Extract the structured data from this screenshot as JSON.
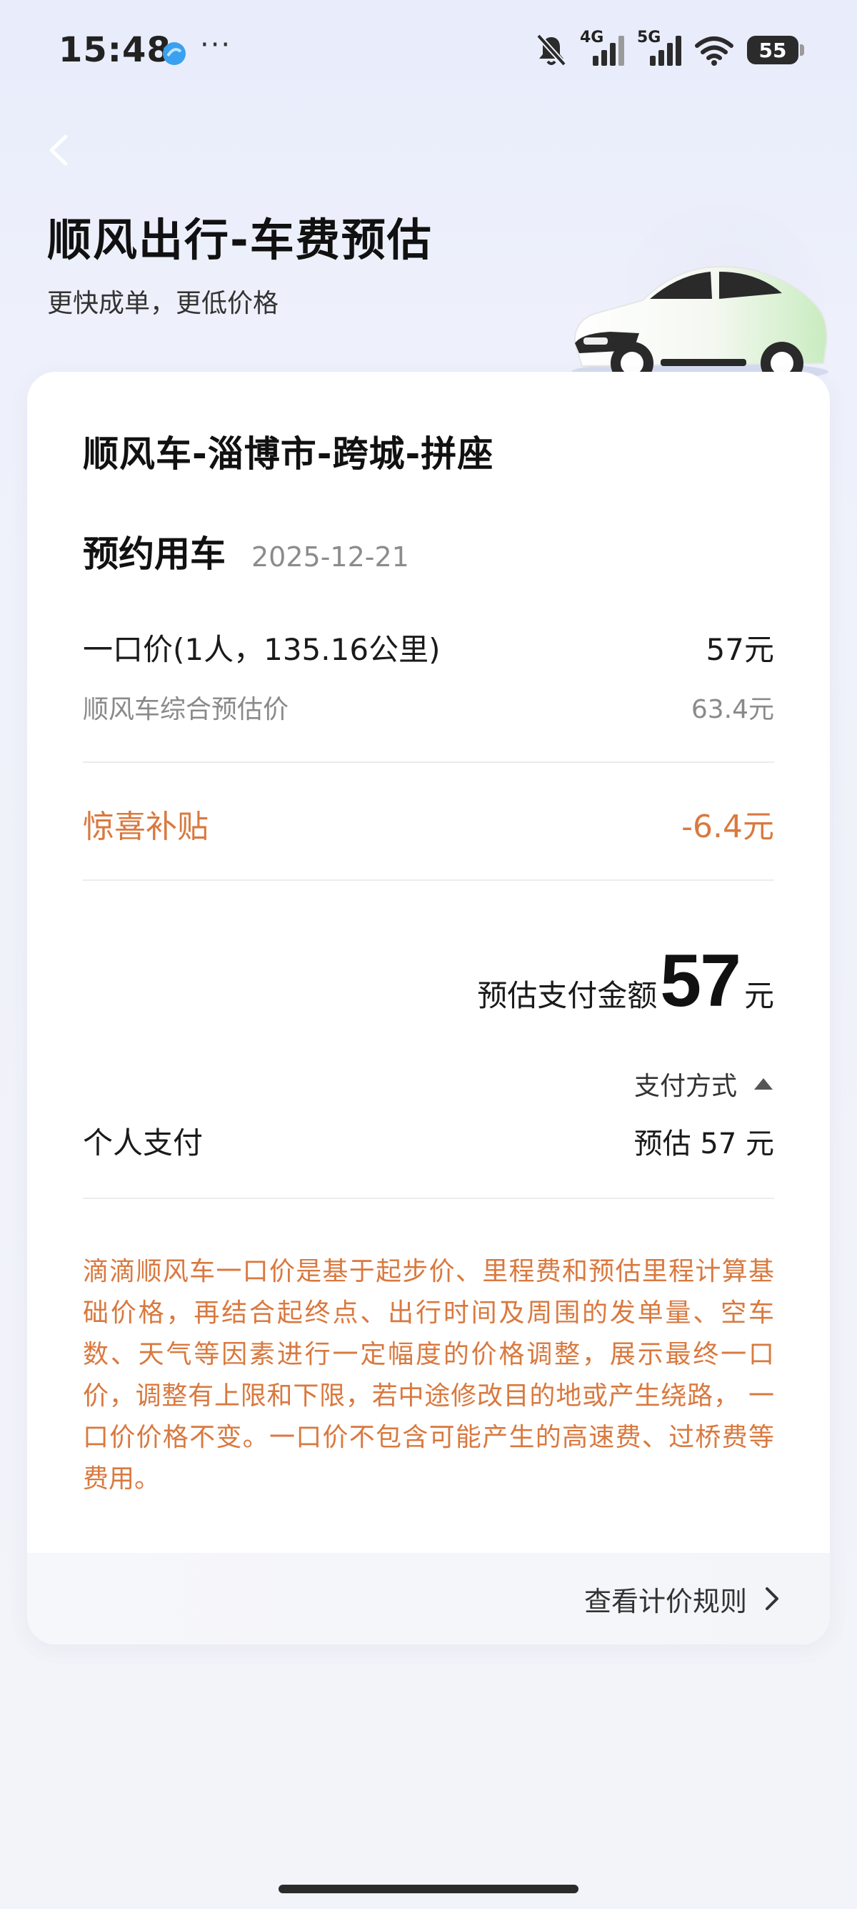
{
  "status_bar": {
    "time": "15:48",
    "more": "···",
    "net_4g": "4G",
    "net_5g": "5G",
    "battery": "55"
  },
  "header": {
    "title": "顺风出行-车费预估",
    "subtitle": "更快成单，更低价格"
  },
  "card": {
    "route_title": "顺风车-淄博市-跨城-拼座",
    "booking_label": "预约用车",
    "booking_date": "2025-12-21",
    "fare_label": "一口价(1人，135.16公里)",
    "fare_value": "57元",
    "estimate_label": "顺风车综合预估价",
    "estimate_value": "63.4元",
    "subsidy_label": "惊喜补贴",
    "subsidy_value": "-6.4元",
    "total_label": "预估支付金额",
    "total_amount": "57",
    "total_unit": "元",
    "paymethod_label": "支付方式",
    "personal_label": "个人支付",
    "personal_value": "预估 57 元",
    "note": "滴滴顺风车一口价是基于起步价、里程费和预估里程计算基础价格，再结合起终点、出行时间及周围的发单量、空车数、天气等因素进行一定幅度的价格调整，展示最终一口价，调整有上限和下限，若中途修改目的地或产生绕路， 一口价价格不变。一口价不包含可能产生的高速费、过桥费等费用。",
    "rules_label": "查看计价规则"
  },
  "icons": {
    "back": "chevron-left-icon",
    "caret": "caret-up-icon",
    "rules": "chevron-right-icon",
    "mute": "bell-off-icon",
    "wifi": "wifi-icon"
  },
  "colors": {
    "accent_orange": "#d9793f",
    "background": "#eef1fb",
    "card": "#ffffff"
  }
}
